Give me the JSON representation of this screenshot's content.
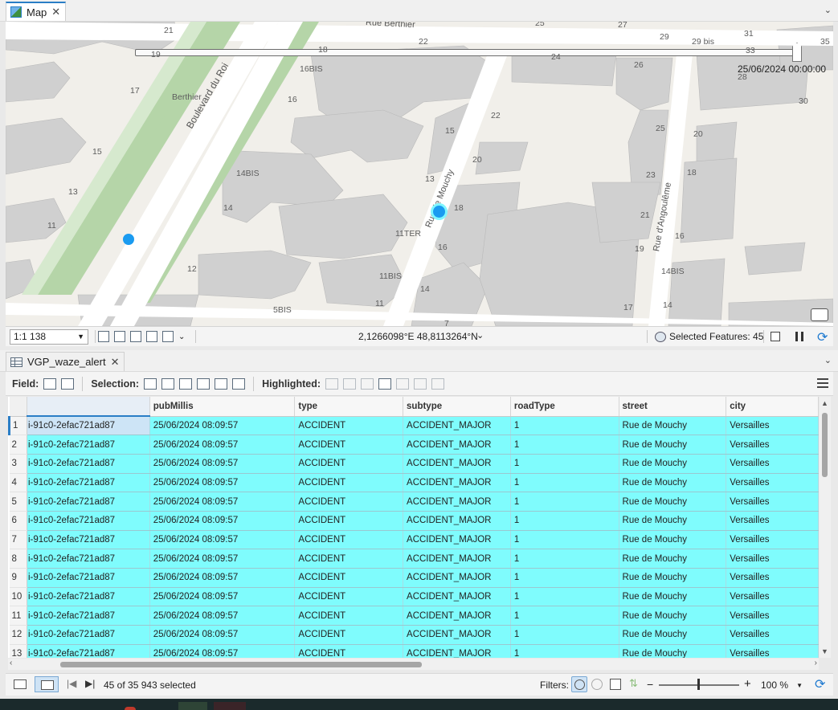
{
  "tabs": {
    "map_tab": "Map",
    "table_tab": "VGP_waze_alert"
  },
  "map": {
    "time_label": "25/06/2024 00:00:00",
    "streets": {
      "rue_berthier": "Rue Berthier",
      "boulevard_du_roi": "Boulevard du Roi",
      "rue_de_mouchy": "Rue de Mouchy",
      "rue_dangouleme": "Rue d'Angoulême",
      "stop_berthier": "Berthier"
    },
    "house_numbers": [
      "21",
      "19",
      "18",
      "22",
      "25",
      "27",
      "29",
      "29 bis",
      "31",
      "33",
      "35",
      "24",
      "26",
      "28",
      "30",
      "17",
      "16BIS",
      "16",
      "15",
      "14BIS",
      "14",
      "13",
      "12",
      "11",
      "15",
      "22",
      "20",
      "13",
      "18",
      "11TER",
      "16",
      "11BIS",
      "14",
      "11",
      "5BIS",
      "7",
      "17",
      "25",
      "20",
      "23",
      "18",
      "21",
      "16",
      "19",
      "14BIS",
      "14",
      "13",
      "15"
    ]
  },
  "map_status": {
    "scale": "1:1 138",
    "coordinates": "2,1266098°E 48,8113264°N",
    "selected_features": "Selected Features: 45"
  },
  "table_toolbar": {
    "field_label": "Field:",
    "selection_label": "Selection:",
    "highlighted_label": "Highlighted:"
  },
  "table": {
    "columns": [
      "",
      "pubMillis",
      "type",
      "subtype",
      "roadType",
      "street",
      "city"
    ],
    "rows": [
      {
        "n": "1",
        "oid": "i-91c0-2efac721ad87",
        "pubMillis": "25/06/2024 08:09:57",
        "type": "ACCIDENT",
        "subtype": "ACCIDENT_MAJOR",
        "roadType": "1",
        "street": "Rue de Mouchy",
        "city": "Versailles"
      },
      {
        "n": "2",
        "oid": "i-91c0-2efac721ad87",
        "pubMillis": "25/06/2024 08:09:57",
        "type": "ACCIDENT",
        "subtype": "ACCIDENT_MAJOR",
        "roadType": "1",
        "street": "Rue de Mouchy",
        "city": "Versailles"
      },
      {
        "n": "3",
        "oid": "i-91c0-2efac721ad87",
        "pubMillis": "25/06/2024 08:09:57",
        "type": "ACCIDENT",
        "subtype": "ACCIDENT_MAJOR",
        "roadType": "1",
        "street": "Rue de Mouchy",
        "city": "Versailles"
      },
      {
        "n": "4",
        "oid": "i-91c0-2efac721ad87",
        "pubMillis": "25/06/2024 08:09:57",
        "type": "ACCIDENT",
        "subtype": "ACCIDENT_MAJOR",
        "roadType": "1",
        "street": "Rue de Mouchy",
        "city": "Versailles"
      },
      {
        "n": "5",
        "oid": "i-91c0-2efac721ad87",
        "pubMillis": "25/06/2024 08:09:57",
        "type": "ACCIDENT",
        "subtype": "ACCIDENT_MAJOR",
        "roadType": "1",
        "street": "Rue de Mouchy",
        "city": "Versailles"
      },
      {
        "n": "6",
        "oid": "i-91c0-2efac721ad87",
        "pubMillis": "25/06/2024 08:09:57",
        "type": "ACCIDENT",
        "subtype": "ACCIDENT_MAJOR",
        "roadType": "1",
        "street": "Rue de Mouchy",
        "city": "Versailles"
      },
      {
        "n": "7",
        "oid": "i-91c0-2efac721ad87",
        "pubMillis": "25/06/2024 08:09:57",
        "type": "ACCIDENT",
        "subtype": "ACCIDENT_MAJOR",
        "roadType": "1",
        "street": "Rue de Mouchy",
        "city": "Versailles"
      },
      {
        "n": "8",
        "oid": "i-91c0-2efac721ad87",
        "pubMillis": "25/06/2024 08:09:57",
        "type": "ACCIDENT",
        "subtype": "ACCIDENT_MAJOR",
        "roadType": "1",
        "street": "Rue de Mouchy",
        "city": "Versailles"
      },
      {
        "n": "9",
        "oid": "i-91c0-2efac721ad87",
        "pubMillis": "25/06/2024 08:09:57",
        "type": "ACCIDENT",
        "subtype": "ACCIDENT_MAJOR",
        "roadType": "1",
        "street": "Rue de Mouchy",
        "city": "Versailles"
      },
      {
        "n": "10",
        "oid": "i-91c0-2efac721ad87",
        "pubMillis": "25/06/2024 08:09:57",
        "type": "ACCIDENT",
        "subtype": "ACCIDENT_MAJOR",
        "roadType": "1",
        "street": "Rue de Mouchy",
        "city": "Versailles"
      },
      {
        "n": "11",
        "oid": "i-91c0-2efac721ad87",
        "pubMillis": "25/06/2024 08:09:57",
        "type": "ACCIDENT",
        "subtype": "ACCIDENT_MAJOR",
        "roadType": "1",
        "street": "Rue de Mouchy",
        "city": "Versailles"
      },
      {
        "n": "12",
        "oid": "i-91c0-2efac721ad87",
        "pubMillis": "25/06/2024 08:09:57",
        "type": "ACCIDENT",
        "subtype": "ACCIDENT_MAJOR",
        "roadType": "1",
        "street": "Rue de Mouchy",
        "city": "Versailles"
      },
      {
        "n": "13",
        "oid": "i-91c0-2efac721ad87",
        "pubMillis": "25/06/2024 08:09:57",
        "type": "ACCIDENT",
        "subtype": "ACCIDENT_MAJOR",
        "roadType": "1",
        "street": "Rue de Mouchy",
        "city": "Versailles"
      }
    ]
  },
  "status_bar": {
    "selection_count": "45 of 35 943 selected",
    "filters_label": "Filters:",
    "zoom": "100 %"
  },
  "colors": {
    "selection_highlight": "#7ffcfd",
    "accent": "#2a7ec6",
    "point": "#1a9bf0"
  }
}
